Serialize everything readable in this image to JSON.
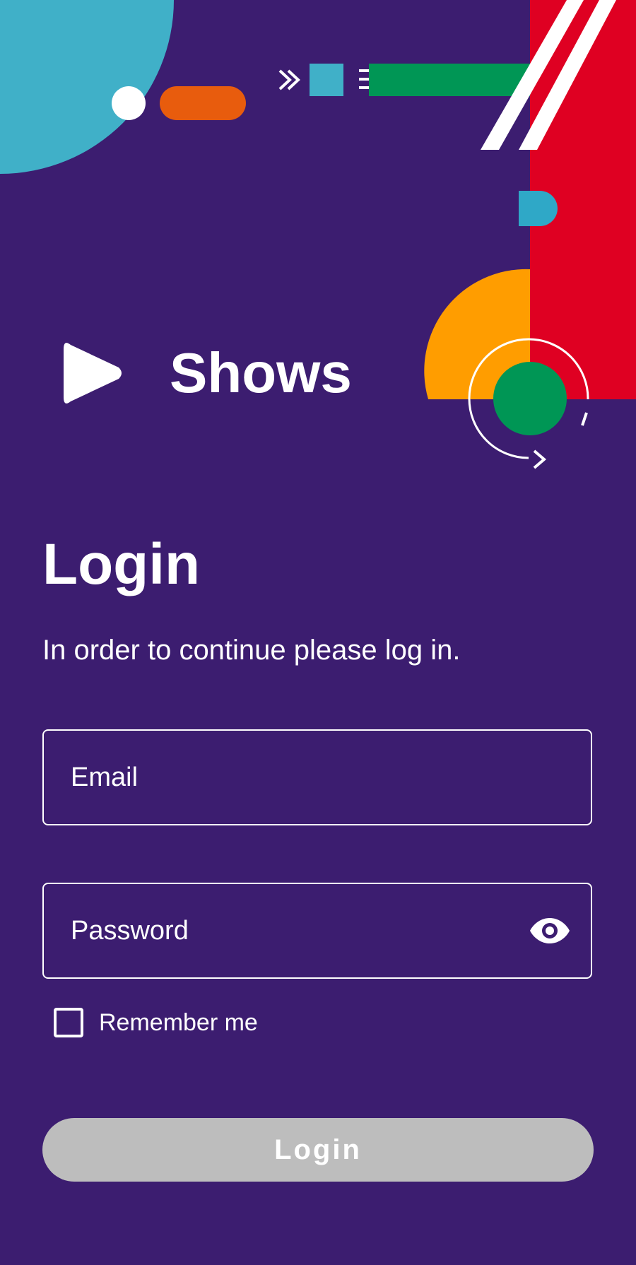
{
  "app": {
    "name": "Shows",
    "logo_icon": "play-icon"
  },
  "login": {
    "title": "Login",
    "subtitle": "In order to continue please log in.",
    "email_placeholder": "Email",
    "email_value": "",
    "password_placeholder": "Password",
    "password_value": "",
    "password_toggle_icon": "eye-icon",
    "remember_label": "Remember me",
    "remember_checked": false,
    "button_label": "Login"
  },
  "colors": {
    "background": "#3c1d70",
    "accent_teal": "#40b0c8",
    "accent_orange": "#e85c0d",
    "accent_yellow": "#ff9d00",
    "accent_green": "#009655",
    "accent_red": "#df0022",
    "button_disabled": "#bdbdbd"
  }
}
